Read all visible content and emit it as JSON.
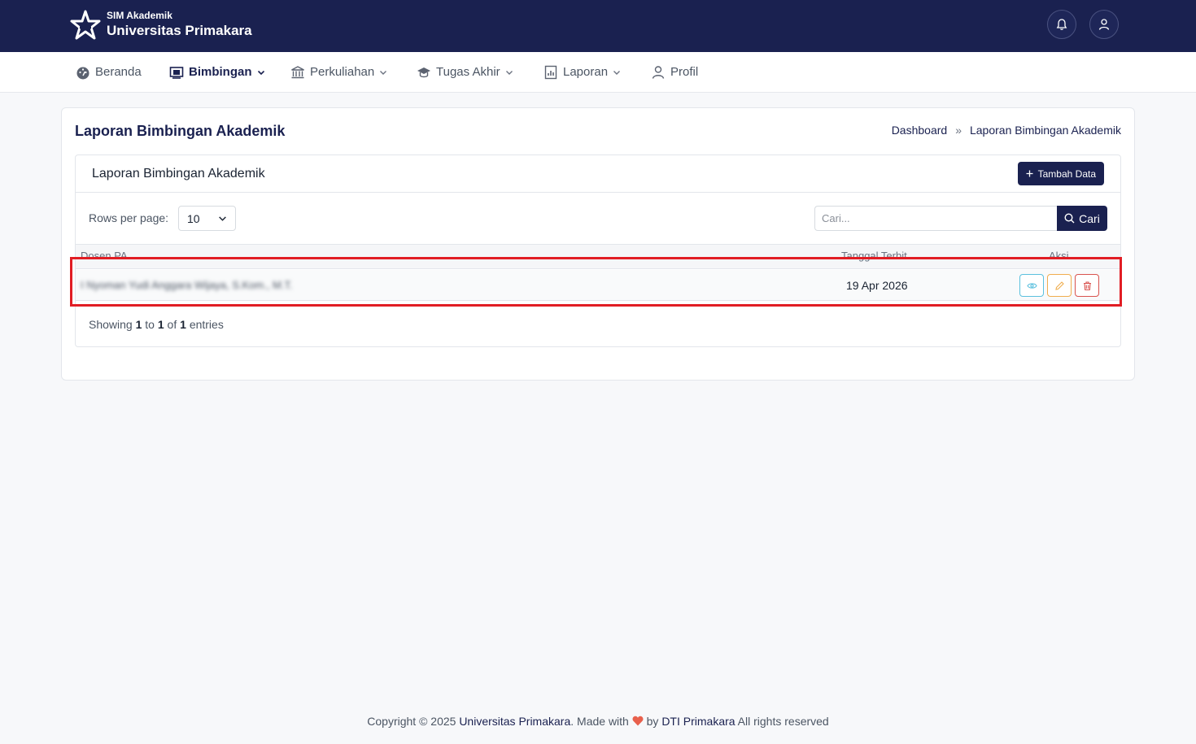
{
  "header": {
    "brand_sub": "SIM Akademik",
    "brand_main": "Universitas Primakara"
  },
  "nav": {
    "items": [
      {
        "label": "Beranda",
        "icon": "dashboard-icon",
        "dropdown": false
      },
      {
        "label": "Bimbingan",
        "icon": "presentation-icon",
        "dropdown": true,
        "active": true
      },
      {
        "label": "Perkuliahan",
        "icon": "bank-icon",
        "dropdown": true
      },
      {
        "label": "Tugas Akhir",
        "icon": "graduation-cap-icon",
        "dropdown": true
      },
      {
        "label": "Laporan",
        "icon": "report-icon",
        "dropdown": true
      },
      {
        "label": "Profil",
        "icon": "user-icon",
        "dropdown": false
      }
    ]
  },
  "page": {
    "title": "Laporan Bimbingan Akademik",
    "breadcrumb": [
      "Dashboard",
      "»",
      "Laporan Bimbingan Akademik"
    ]
  },
  "panel": {
    "title": "Laporan Bimbingan Akademik",
    "add_button": "Tambah Data",
    "rows_label": "Rows per page:",
    "rows_value": "10",
    "search_placeholder": "Cari...",
    "search_button": "Cari"
  },
  "table": {
    "columns": [
      "Dosen PA",
      "Tanggal Terbit",
      "Aksi"
    ],
    "rows": [
      {
        "dosen": "I Nyoman Yudi Anggara Wijaya, S.Kom., M.T.",
        "tanggal": "19 Apr 2026"
      }
    ]
  },
  "pagination": {
    "showing": "Showing",
    "from": "1",
    "to_word": "to",
    "to": "1",
    "of_word": "of",
    "total": "1",
    "entries": "entries"
  },
  "footer": {
    "copyright": "Copyright © 2025",
    "org": "Universitas Primakara",
    "made_with": ". Made with",
    "by": "by",
    "team": "DTI Primakara",
    "rights": "All rights reserved"
  },
  "colors": {
    "primary": "#1a2150",
    "highlight": "#e11d24",
    "view": "#5bc0de",
    "edit": "#f0ad4e",
    "delete": "#d9534f",
    "heart": "#e8604c"
  }
}
